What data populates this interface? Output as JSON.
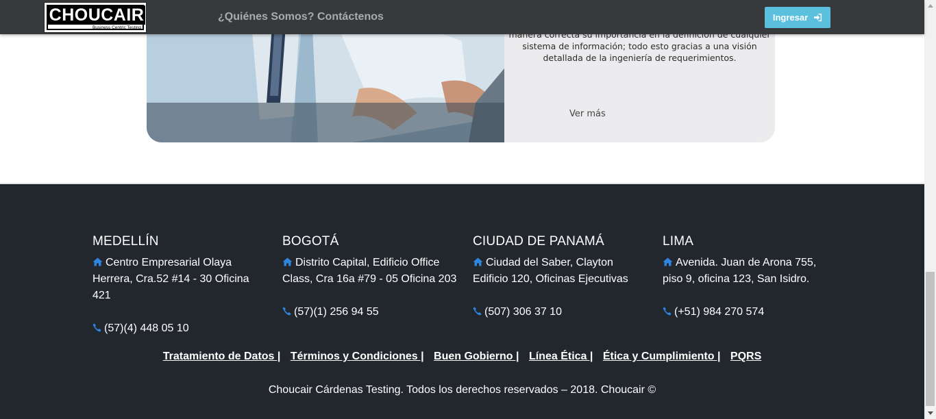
{
  "navbar": {
    "logo": {
      "brand": "CHOUCAIR",
      "tagline": "Business Centric Testing"
    },
    "links": [
      "¿Quiénes Somos?",
      "Contáctenos"
    ],
    "login_label": "Ingresar",
    "login_color": "#5bc0de"
  },
  "card": {
    "text": "manera correcta su importancia en la definición de cualquier sistema de información; todo esto gracias a una visión detallada de la ingeniería de requerimientos.",
    "more_label": "Ver más"
  },
  "footer": {
    "offices": [
      {
        "city": "MEDELLÍN",
        "address": "Centro Empresarial Olaya Herrera, Cra.52 #14 - 30 Oficina 421",
        "phone": "(57)(4) 448 05 10"
      },
      {
        "city": "BOGOTÁ",
        "address": "Distrito Capital, Edificio Office Class, Cra 16a #79 - 05 Oficina 203",
        "phone": "(57)(1) 256 94 55"
      },
      {
        "city": "CIUDAD DE PANAMÁ",
        "address": "Ciudad del Saber, Clayton Edificio 120, Oficinas Ejecutivas",
        "phone": "(507) 306 37 10"
      },
      {
        "city": "LIMA",
        "address": "Avenida. Juan de Arona 755, piso 9, oficina 123, San Isidro.",
        "phone": "(+51) 984 270 574"
      }
    ],
    "links": [
      "Tratamiento de Datos |",
      "Términos y Condiciones |",
      "Buen Gobierno |",
      "Línea Ética |",
      "Ética y Cumplimiento |",
      "PQRS"
    ],
    "copyright": "Choucair Cárdenas Testing. Todos los derechos reservados – 2018. Choucair ©",
    "icon_color": "#2e86de"
  }
}
